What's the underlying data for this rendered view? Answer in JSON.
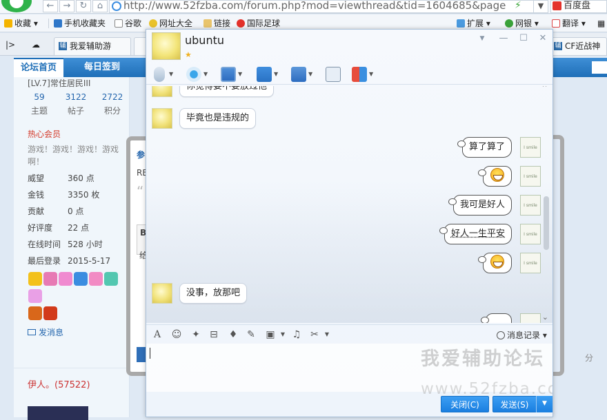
{
  "browser": {
    "url": "http://www.52fzba.com/forum.php?mod=viewthread&tid=1604685&page",
    "search_text": "百度盘",
    "bookmarks": [
      {
        "label": "收藏",
        "icon": "star-icon"
      },
      {
        "label": "手机收藏夹",
        "icon": "phone-icon"
      },
      {
        "label": "谷歌",
        "icon": "page-icon"
      },
      {
        "label": "网址大全",
        "icon": "globe-icon"
      },
      {
        "label": "链接",
        "icon": "folder-icon"
      },
      {
        "label": "国际足球",
        "icon": "weibo-icon"
      }
    ],
    "extensions": [
      {
        "label": "扩展",
        "icon": "puzzle-icon"
      },
      {
        "label": "网银",
        "icon": "bank-icon"
      },
      {
        "label": "翻译",
        "icon": "translate-icon"
      }
    ],
    "tabs": [
      {
        "label": "我爱辅助游"
      },
      {
        "label": "CF近战神"
      }
    ]
  },
  "forum": {
    "nav": {
      "home": "论坛首页",
      "checkin": "每日签到"
    },
    "level": "[LV.7]常住居民III",
    "stats": [
      {
        "value": "59",
        "label": "主题"
      },
      {
        "value": "3122",
        "label": "帖子"
      },
      {
        "value": "2722",
        "label": "积分"
      }
    ],
    "group": "热心会员",
    "signature": "游戏！游戏！游戏！游戏啊！",
    "profile": [
      {
        "key": "威望",
        "value": "360 点"
      },
      {
        "key": "金钱",
        "value": "3350 枚"
      },
      {
        "key": "贡献",
        "value": "0 点"
      },
      {
        "key": "好评度",
        "value": "22 点"
      },
      {
        "key": "在线时间",
        "value": "528 小时"
      },
      {
        "key": "最后登录",
        "value": "2015-5-17"
      }
    ],
    "send_message": "发消息",
    "next_user": "伊人。",
    "next_user_id": "(57522)",
    "post_fragments": {
      "title": "参",
      "reply": "RE",
      "quote": "“",
      "code": "B",
      "body": "给"
    },
    "right_fragment": "分"
  },
  "chat": {
    "contact_name": "ubuntu",
    "messages": [
      {
        "side": "left",
        "text": "你觉得要不要放过他"
      },
      {
        "side": "left",
        "text": "毕竟也是违规的"
      },
      {
        "side": "right",
        "text": "算了算了"
      },
      {
        "side": "right",
        "text": "",
        "emoji": "grin-emoji"
      },
      {
        "side": "right",
        "text": "我可是好人"
      },
      {
        "side": "right",
        "text": "好人一生平安"
      },
      {
        "side": "right",
        "text": "",
        "emoji": "grin-emoji"
      },
      {
        "side": "left",
        "text": "没事，放那吧"
      }
    ],
    "my_avatar_text": "I smile",
    "history_label": "消息记录",
    "close_label": "关闭(C)",
    "send_label": "发送(S)",
    "watermark_cn": "我爱辅助论坛",
    "watermark_url": "www.52fzba.com"
  },
  "colors": {
    "accent": "#1a7fe0",
    "forum_nav": "#2a79c4",
    "group_red": "#d43a2a"
  }
}
